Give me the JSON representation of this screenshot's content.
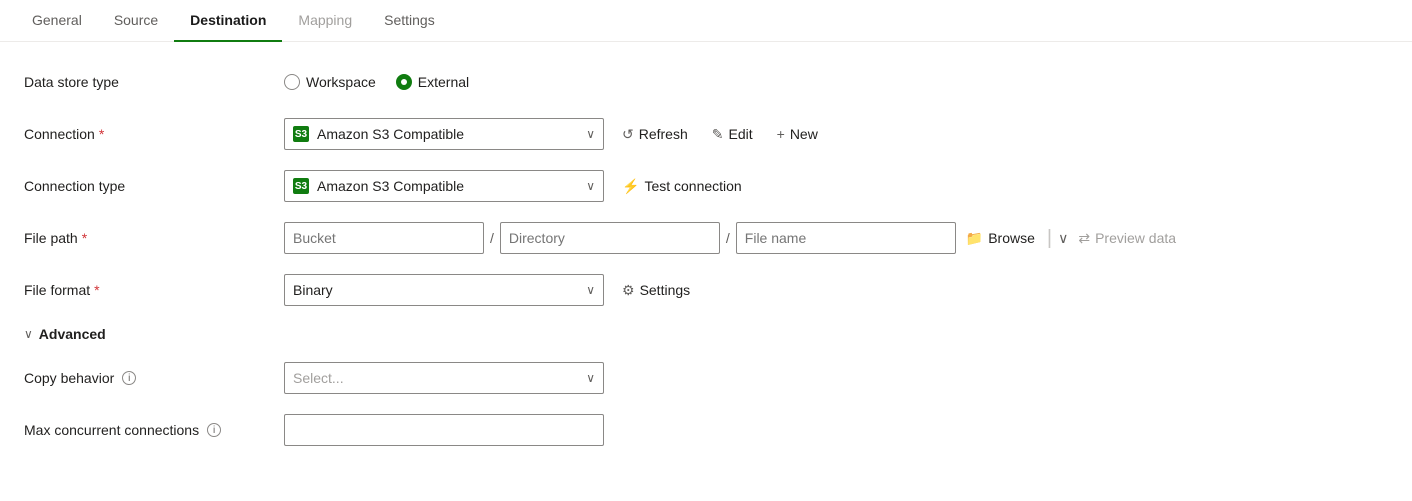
{
  "tabs": [
    {
      "id": "general",
      "label": "General",
      "active": false,
      "disabled": false
    },
    {
      "id": "source",
      "label": "Source",
      "active": false,
      "disabled": false
    },
    {
      "id": "destination",
      "label": "Destination",
      "active": true,
      "disabled": false
    },
    {
      "id": "mapping",
      "label": "Mapping",
      "active": false,
      "disabled": true
    },
    {
      "id": "settings",
      "label": "Settings",
      "active": false,
      "disabled": false
    }
  ],
  "form": {
    "dataStoreType": {
      "label": "Data store type",
      "options": [
        {
          "id": "workspace",
          "label": "Workspace",
          "checked": false
        },
        {
          "id": "external",
          "label": "External",
          "checked": true
        }
      ]
    },
    "connection": {
      "label": "Connection",
      "required": true,
      "value": "Amazon S3 Compatible",
      "actions": {
        "refresh": "Refresh",
        "edit": "Edit",
        "new": "New"
      }
    },
    "connectionType": {
      "label": "Connection type",
      "required": false,
      "value": "Amazon S3 Compatible",
      "actions": {
        "testConnection": "Test connection"
      }
    },
    "filePath": {
      "label": "File path",
      "required": true,
      "bucketPlaceholder": "Bucket",
      "directoryPlaceholder": "Directory",
      "filenamePlaceholder": "File name",
      "browseLabel": "Browse",
      "previewLabel": "Preview data"
    },
    "fileFormat": {
      "label": "File format",
      "required": true,
      "value": "Binary",
      "settingsLabel": "Settings"
    },
    "advanced": {
      "label": "Advanced"
    },
    "copyBehavior": {
      "label": "Copy behavior",
      "placeholder": "Select...",
      "infoTooltip": "Copy behavior info"
    },
    "maxConcurrentConnections": {
      "label": "Max concurrent connections",
      "infoTooltip": "Max concurrent connections info",
      "value": ""
    }
  },
  "icons": {
    "amazonS3": "S3",
    "refresh": "↺",
    "edit": "✎",
    "new": "+",
    "testConnection": "⚡",
    "browse": "📁",
    "settings": "⚙",
    "chevronDown": "∨",
    "chevronRight": "∨",
    "previewData": "⇄",
    "info": "i"
  }
}
